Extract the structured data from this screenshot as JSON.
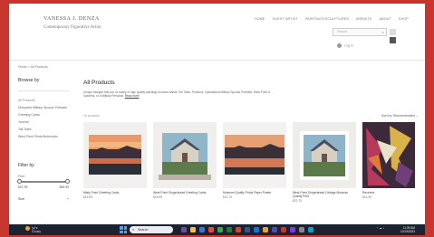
{
  "header": {
    "artist_name": "VANESSA J. DENZA",
    "tagline": "Contemporary Figurative Artist",
    "nav": [
      "HOME",
      "GUEST ARTIST",
      "PAINTINGS/SCULPTURES",
      "WEBSITE",
      "ABOUT",
      "SHOP"
    ],
    "search_placeholder": "Search",
    "account_label": "Log In"
  },
  "breadcrumb": "Home  >  All Products",
  "sidebar": {
    "browse_heading": "Browse by",
    "categories": [
      "All Products",
      "Disrupted Military Spouse Portraits",
      "Greeting Cards",
      "Journal",
      "Tall Totes",
      "West Point Prints/Notecards"
    ],
    "active_index": 0,
    "price_heading": "Filter by",
    "price_label": "Price",
    "price_min": "$21.99",
    "price_max": "$69.99",
    "size_label": "Size",
    "size_toggle": "+"
  },
  "main": {
    "title": "All Products",
    "intro": "Unique designs that you so easily of high quality paintings sourced artists' Tall Totes, Products, Operational Military Spouse Portraits, West Point & Gardens, or a Military Personal.",
    "read_more": "Read more",
    "product_count": "15 products",
    "sort_label": "Sort by: Recommended  ⌄",
    "products": [
      {
        "name": "Misty Point Greeting Cards",
        "price": "$18.99"
      },
      {
        "name": "West Point Gingerbread Greeting Cards",
        "price": "$18.99"
      },
      {
        "name": "Museum Quality Prints Paper Poster",
        "price": "$22.75"
      },
      {
        "name": "West Point Gingerbread Cottage Museum Quality Print",
        "price": "$22.75"
      },
      {
        "name": "Reverent",
        "price": "$14.99"
      }
    ]
  },
  "taskbar": {
    "weather_temp": "54°F",
    "weather_desc": "Cloudy",
    "search_text": "Search",
    "tray": "⌃  ☁  ♪",
    "time": "11:39 AM",
    "date": "12/19/2023"
  },
  "colors": {
    "background_wall": "#c8352c",
    "taskbar": "#1d2230",
    "text_dark": "#222222"
  }
}
